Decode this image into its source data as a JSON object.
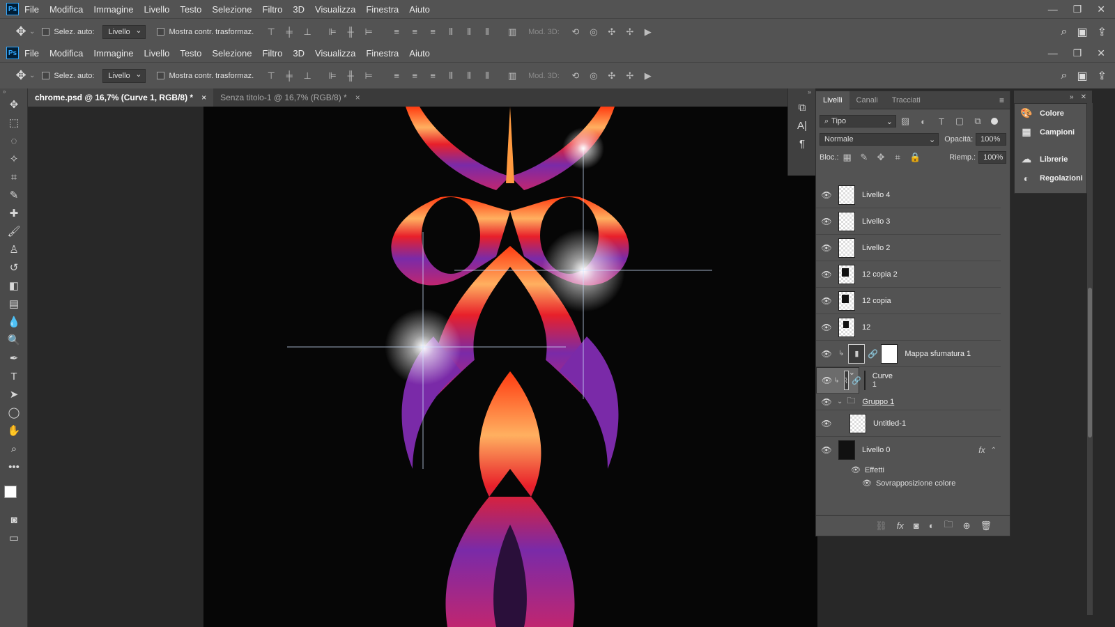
{
  "app": {
    "logo": "Ps"
  },
  "menu": [
    "File",
    "Modifica",
    "Immagine",
    "Livello",
    "Testo",
    "Selezione",
    "Filtro",
    "3D",
    "Visualizza",
    "Finestra",
    "Aiuto"
  ],
  "window_controls": [
    "minimize-icon",
    "restore-icon",
    "close-icon"
  ],
  "options": {
    "auto_select_label": "Selez. auto:",
    "auto_select_value": "Livello",
    "show_transform_label": "Mostra contr. trasformaz.",
    "mode3d_label": "Mod. 3D:"
  },
  "doc_tabs": [
    {
      "label": "chrome.psd @ 16,7% (Curve 1, RGB/8) *",
      "close": "×"
    },
    {
      "label": "Senza titolo-1 @ 16,7% (RGB/8) *",
      "close": "×"
    }
  ],
  "tools": [
    "move-icon",
    "marquee-icon",
    "lasso-icon",
    "magic-wand-icon",
    "crop-icon",
    "eyedropper-icon",
    "healing-icon",
    "brush-icon",
    "stamp-icon",
    "history-brush-icon",
    "eraser-icon",
    "gradient-icon",
    "blur-icon",
    "dodge-icon",
    "pen-icon",
    "type-icon",
    "path-select-icon",
    "ellipse-icon",
    "hand-icon",
    "zoom-icon",
    "more-icon"
  ],
  "layers_panel": {
    "tabs": [
      "Livelli",
      "Canali",
      "Tracciati"
    ],
    "filter_kind": "Tipo",
    "blend_mode": "Normale",
    "opacity_label": "Opacità:",
    "opacity_value": "100%",
    "lock_label": "Bloc.:",
    "fill_label": "Riemp.:",
    "fill_value": "100%",
    "layers": [
      {
        "name": "Livello 4",
        "type": "transparent"
      },
      {
        "name": "Livello 3",
        "type": "transparent"
      },
      {
        "name": "Livello 2",
        "type": "transparent"
      },
      {
        "name": "12 copia 2",
        "type": "smart"
      },
      {
        "name": "12 copia",
        "type": "smart"
      },
      {
        "name": "12",
        "type": "smart"
      },
      {
        "name": "Mappa sfumatura 1",
        "type": "adjustment"
      },
      {
        "name": "Curve 1",
        "type": "adjustment",
        "selected": true
      },
      {
        "name": "Gruppo 1",
        "type": "group"
      },
      {
        "name": "Untitled-1",
        "type": "smart"
      },
      {
        "name": "Livello 0",
        "type": "fill",
        "fx": "fx"
      }
    ],
    "effects_label": "Effetti",
    "effect_item": "Sovrapposizione colore"
  },
  "right_panels": [
    "Colore",
    "Campioni",
    "Librerie",
    "Regolazioni"
  ],
  "colors": {
    "accent": "#31a8ff",
    "glow_orange": "#ff7a1a",
    "glow_red": "#e8202a",
    "glow_purple": "#7a2aa8"
  }
}
